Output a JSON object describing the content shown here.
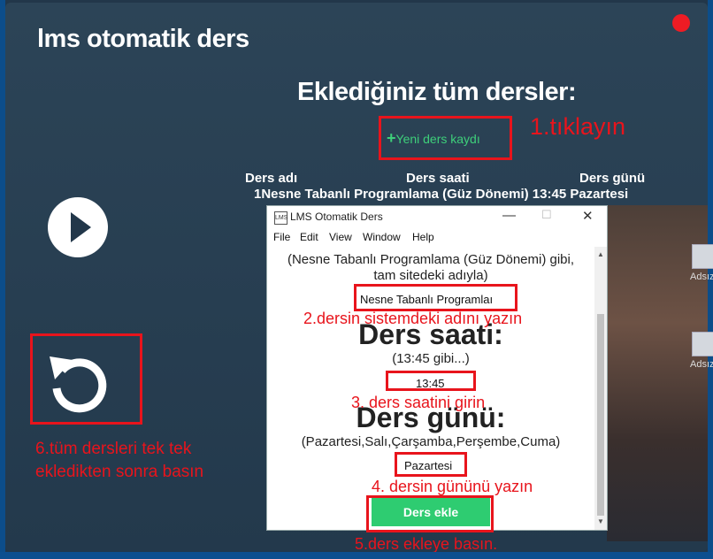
{
  "app": {
    "title": "lms otomatik ders",
    "heading": "Eklediğiniz tüm dersler:",
    "new_button": "Yeni ders kaydı"
  },
  "table": {
    "headers": [
      "Ders adı",
      "Ders saati",
      "Ders günü"
    ],
    "row": "1Nesne Tabanlı Programlama (Güz Dönemi) 13:45 Pazartesi"
  },
  "desktop": {
    "icon_label": "Adsız"
  },
  "window": {
    "title": "LMS Otomatik Ders",
    "menu": [
      "File",
      "Edit",
      "View",
      "Window",
      "Help"
    ],
    "hint_name_line1": "(Nesne Tabanlı Programlama (Güz Dönemi) gibi,",
    "hint_name_line2": "tam sitedeki adıyla)",
    "name_value": "Nesne Tabanlı Programlaı",
    "time_heading": "Ders saati:",
    "time_hint": "(13:45 gibi...)",
    "time_value": "13:45",
    "day_heading": "Ders günü:",
    "day_hint": "(Pazartesi,Salı,Çarşamba,Perşembe,Cuma)",
    "day_value": "Pazartesi",
    "add_button": "Ders ekle"
  },
  "annotations": {
    "step1": "1.tıklayın",
    "step2": "2.dersin sistemdeki adını yazın",
    "step3": "3. ders saatini girin",
    "step4": "4. dersin gününü yazın",
    "step5": "5.ders ekleye basın.",
    "step6_line1": "6.tüm dersleri tek tek",
    "step6_line2": "ekledikten sonra basın"
  },
  "colors": {
    "accent_green": "#2ecc71",
    "annotation_red": "#e8141c",
    "app_bg": "#2a4256"
  }
}
